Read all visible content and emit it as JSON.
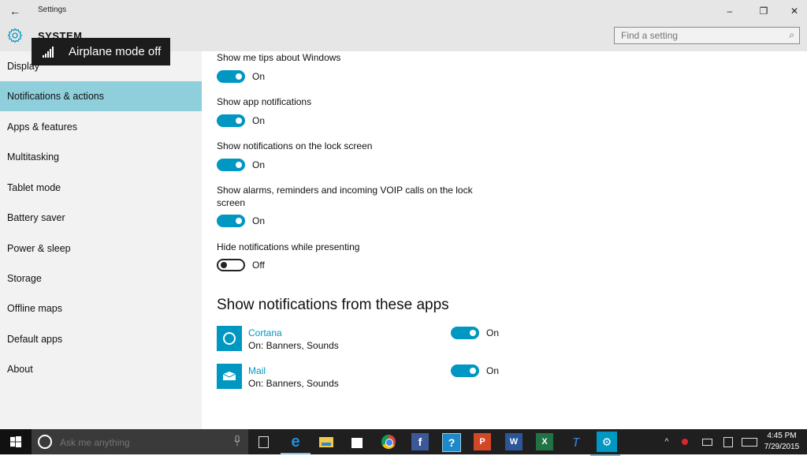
{
  "window": {
    "title": "Settings",
    "back_icon": "back-arrow-icon",
    "controls": {
      "minimize": "–",
      "maximize": "❐",
      "close": "✕"
    }
  },
  "header": {
    "section": "SYSTEM",
    "search_placeholder": "Find a setting",
    "search_value": ""
  },
  "tooltip": {
    "text": "Airplane mode off"
  },
  "sidebar": {
    "items": [
      {
        "label": "Display"
      },
      {
        "label": "Notifications & actions",
        "selected": true
      },
      {
        "label": "Apps & features"
      },
      {
        "label": "Multitasking"
      },
      {
        "label": "Tablet mode"
      },
      {
        "label": "Battery saver"
      },
      {
        "label": "Power & sleep"
      },
      {
        "label": "Storage"
      },
      {
        "label": "Offline maps"
      },
      {
        "label": "Default apps"
      },
      {
        "label": "About"
      }
    ]
  },
  "settings": [
    {
      "label": "Show me tips about Windows",
      "state": "On"
    },
    {
      "label": "Show app notifications",
      "state": "On"
    },
    {
      "label": "Show notifications on the lock screen",
      "state": "On"
    },
    {
      "label": "Show alarms, reminders and incoming VOIP calls on the lock screen",
      "state": "On"
    },
    {
      "label": "Hide notifications while presenting",
      "state": "Off"
    }
  ],
  "apps_section": {
    "title": "Show notifications from these apps",
    "apps": [
      {
        "name": "Cortana",
        "detail": "On: Banners, Sounds",
        "state": "On",
        "icon": "cortana-icon"
      },
      {
        "name": "Mail",
        "detail": "On: Banners, Sounds",
        "state": "On",
        "icon": "mail-icon"
      }
    ]
  },
  "taskbar": {
    "search_placeholder": "Ask me anything",
    "pinned": [
      "task-view",
      "edge",
      "file-explorer",
      "store",
      "chrome",
      "facebook",
      "help",
      "powerpoint",
      "word",
      "excel",
      "unknown-app",
      "settings"
    ],
    "time": "4:45 PM",
    "date": "7/29/2015"
  },
  "colors": {
    "accent": "#0097c2",
    "selected": "#8fcfdc"
  }
}
